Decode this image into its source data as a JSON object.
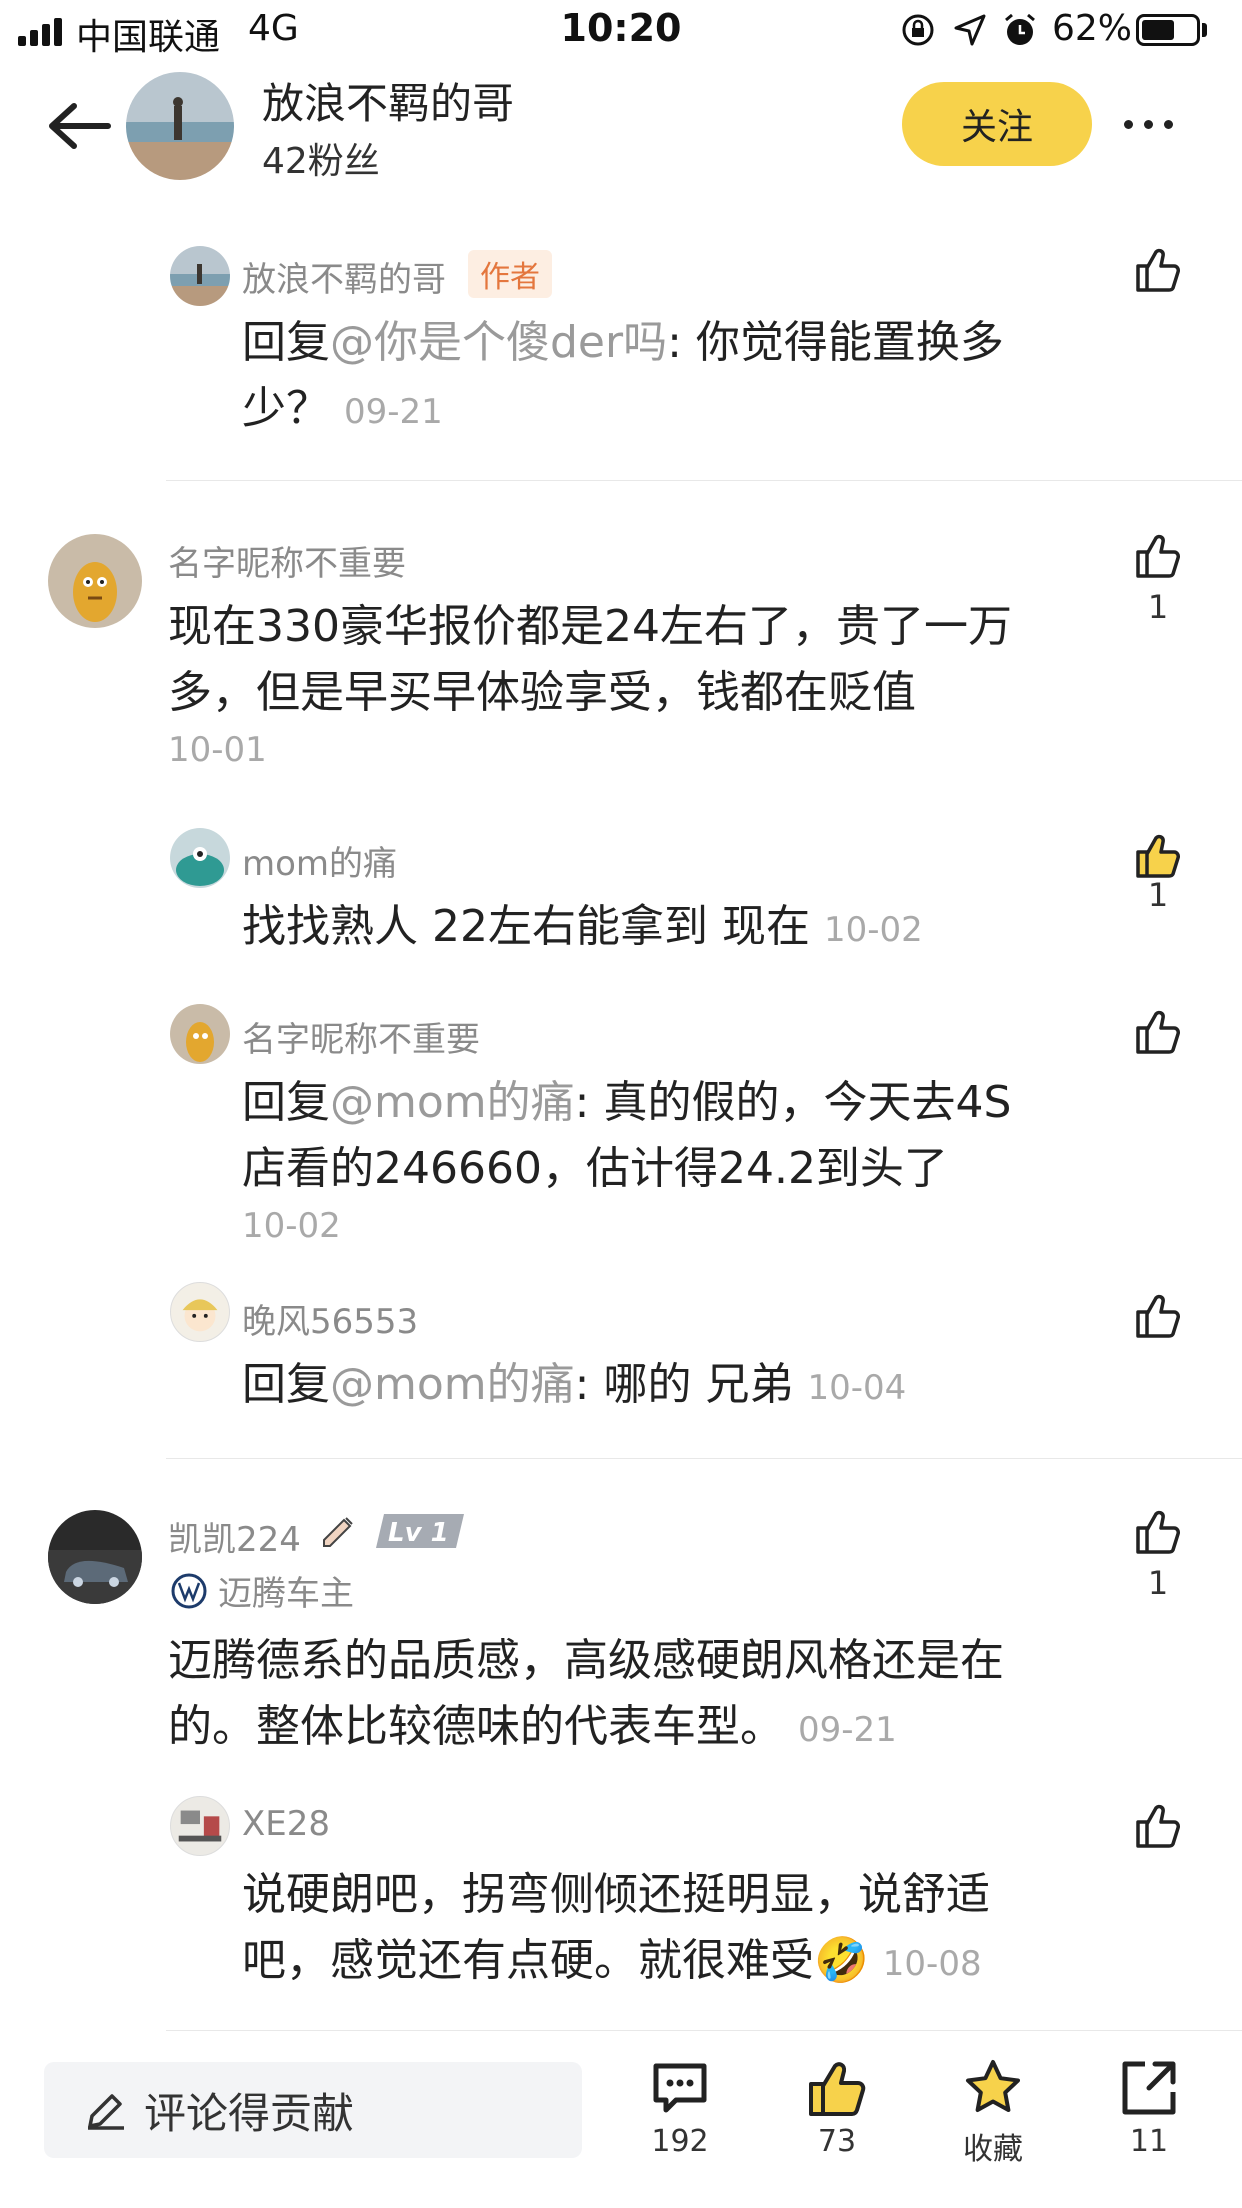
{
  "status": {
    "carrier": "中国联通",
    "network": "4G",
    "time": "10:20",
    "battery_percent": "62%",
    "battery_level": 0.62
  },
  "header": {
    "name": "放浪不羁的哥",
    "fans": "42粉丝",
    "follow_label": "关注"
  },
  "comments": [
    {
      "user": "放浪不羁的哥",
      "badge": "作者",
      "prefix": "回复",
      "mention": "@你是个傻der吗",
      "text_line1": ": 你觉得能置换多",
      "text_line2": "少？",
      "date": "09-21",
      "likes": ""
    },
    {
      "user": "名字昵称不重要",
      "text_line1": "现在330豪华报价都是24左右了，贵了一万",
      "text_line2": "多，但是早买早体验享受，钱都在贬值",
      "date": "10-01",
      "likes": "1"
    },
    {
      "user": "mom的痛",
      "text_line1": "找找熟人 22左右能拿到 现在",
      "date": "10-02",
      "likes": "1",
      "liked": true
    },
    {
      "user": "名字昵称不重要",
      "prefix": "回复",
      "mention": "@mom的痛",
      "text_line1": ": 真的假的，今天去4S",
      "text_line2": "店看的246660，估计得24.2到头了",
      "date": "10-02",
      "likes": ""
    },
    {
      "user": "晚风56553",
      "prefix": "回复",
      "mention": "@mom的痛",
      "text_line1": ": 哪的 兄弟",
      "date": "10-04",
      "likes": ""
    },
    {
      "user": "凯凯224",
      "level": "Lv 1",
      "owner": "迈腾车主",
      "text_line1": "迈腾德系的品质感，高级感硬朗风格还是在",
      "text_line2": "的。整体比较德味的代表车型。",
      "date": "09-21",
      "likes": "1"
    },
    {
      "user": "XE28",
      "text_line1": "说硬朗吧，拐弯侧倾还挺明显，说舒适",
      "text_line2": "吧，感觉还有点硬。就很难受",
      "emoji": "🤣",
      "date": "10-08",
      "likes": ""
    }
  ],
  "bottom": {
    "comment_placeholder": "评论得贡献",
    "comments_count": "192",
    "likes_count": "73",
    "favorite_label": "收藏",
    "share_count": "11"
  },
  "colors": {
    "accent_yellow": "#f7d24b",
    "author_badge": "#e4763d",
    "muted_text": "#8a8a8a"
  },
  "icons": [
    "back-arrow-icon",
    "more-icon",
    "thumbs-up-icon",
    "comment-icon",
    "star-icon",
    "share-icon",
    "edit-icon",
    "volkswagen-logo-icon"
  ]
}
